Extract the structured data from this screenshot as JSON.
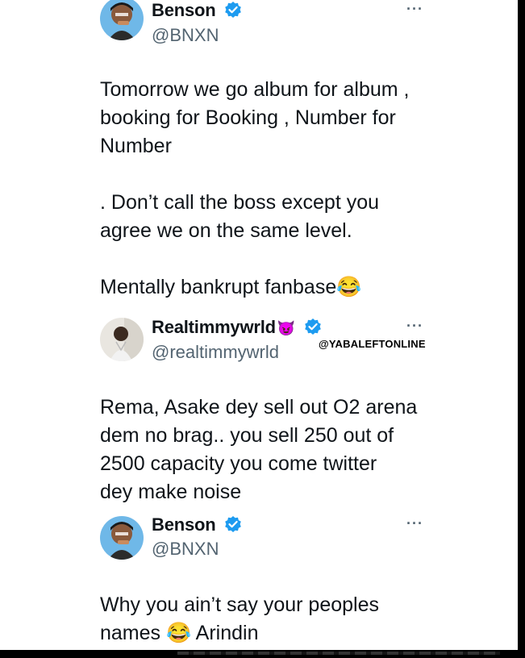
{
  "tweets": [
    {
      "name": "Benson",
      "handle": "@BNXN",
      "more": "···",
      "text": [
        "Tomorrow we go album for album ,",
        "booking  for Booking , Number for",
        "Number",
        "",
        ". Don’t call the boss except you",
        "agree we on the same level.",
        "",
        "Mentally bankrupt fanbase😂"
      ]
    },
    {
      "name": "Realtimmywrld",
      "name_emoji": "😈",
      "handle": "@realtimmywrld",
      "more": "···",
      "text": [
        "Rema, Asake dey sell out O2 arena",
        "dem no brag.. you sell 250 out of",
        "2500 capacity you come twitter",
        "dey make noise"
      ]
    },
    {
      "name": "Benson",
      "handle": "@BNXN",
      "more": "···",
      "text": [
        "Why you ain’t say your peoples",
        "names 😂 Arindin"
      ]
    }
  ],
  "watermark": "@YABALEFTONLINE",
  "colors": {
    "verified": "#1d9bf0",
    "secondary_text": "#536471"
  },
  "icons": [
    "verified-badge-icon",
    "more-options-icon",
    "avatar"
  ]
}
